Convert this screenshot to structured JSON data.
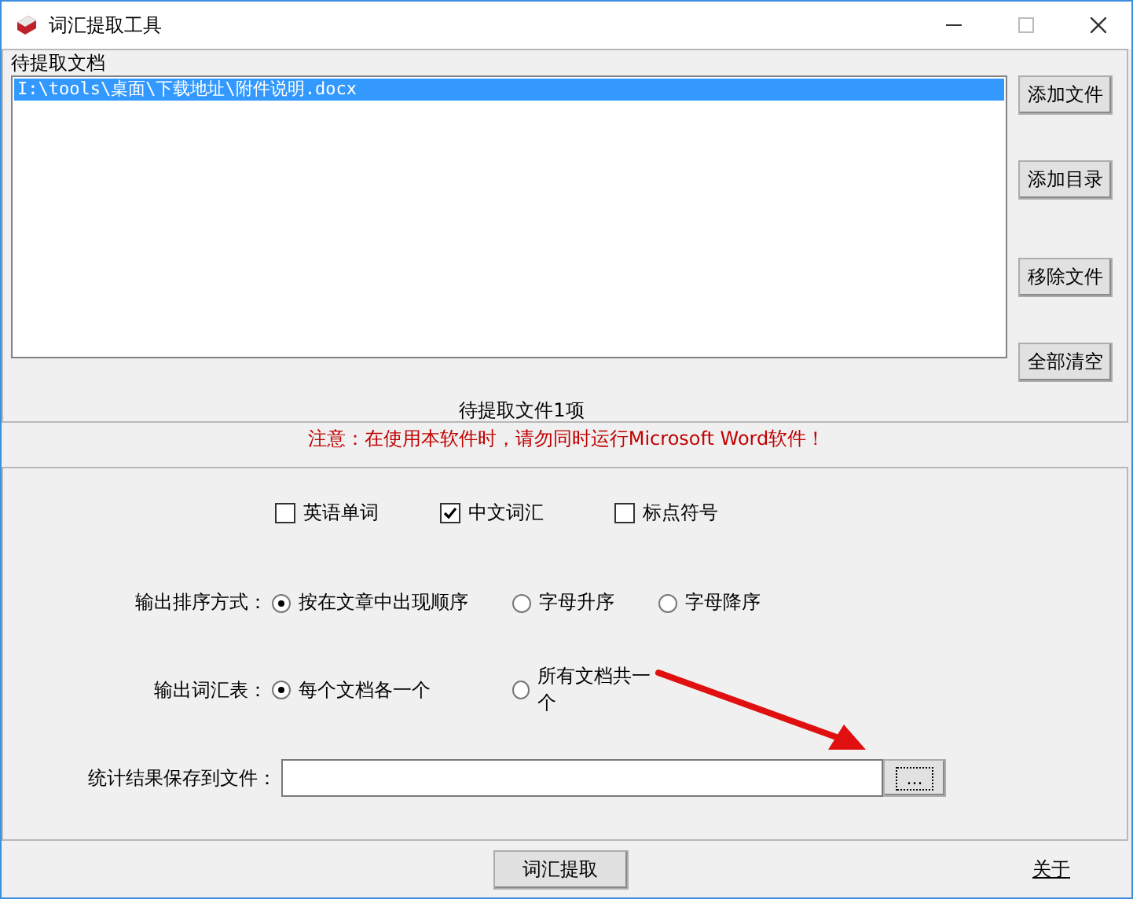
{
  "window": {
    "title": "词汇提取工具"
  },
  "documents": {
    "label": "待提取文档",
    "files": [
      {
        "path": "I:\\tools\\桌面\\下载地址\\附件说明.docx",
        "selected": true
      }
    ],
    "buttons": [
      "添加文件",
      "添加目录",
      "移除文件",
      "全部清空"
    ],
    "status": "待提取文件1项"
  },
  "warning": "注意：在使用本软件时，请勿同时运行Microsoft Word软件！",
  "options": {
    "content_types": [
      {
        "label": "英语单词",
        "checked": false
      },
      {
        "label": "中文词汇",
        "checked": true
      },
      {
        "label": "标点符号",
        "checked": false
      }
    ],
    "sort": {
      "label": "输出排序方式：",
      "choices": [
        {
          "label": "按在文章中出现顺序",
          "selected": true
        },
        {
          "label": "字母升序",
          "selected": false
        },
        {
          "label": "字母降序",
          "selected": false
        }
      ]
    },
    "word_list": {
      "label": "输出词汇表：",
      "choices": [
        {
          "label": "每个文档各一个",
          "selected": true
        },
        {
          "label": "所有文档共一个",
          "selected": false
        }
      ]
    },
    "save": {
      "label": "统计结果保存到文件：",
      "browse_button": "..."
    }
  },
  "actions": {
    "extract_button": "词汇提取",
    "about_link": "关于"
  }
}
